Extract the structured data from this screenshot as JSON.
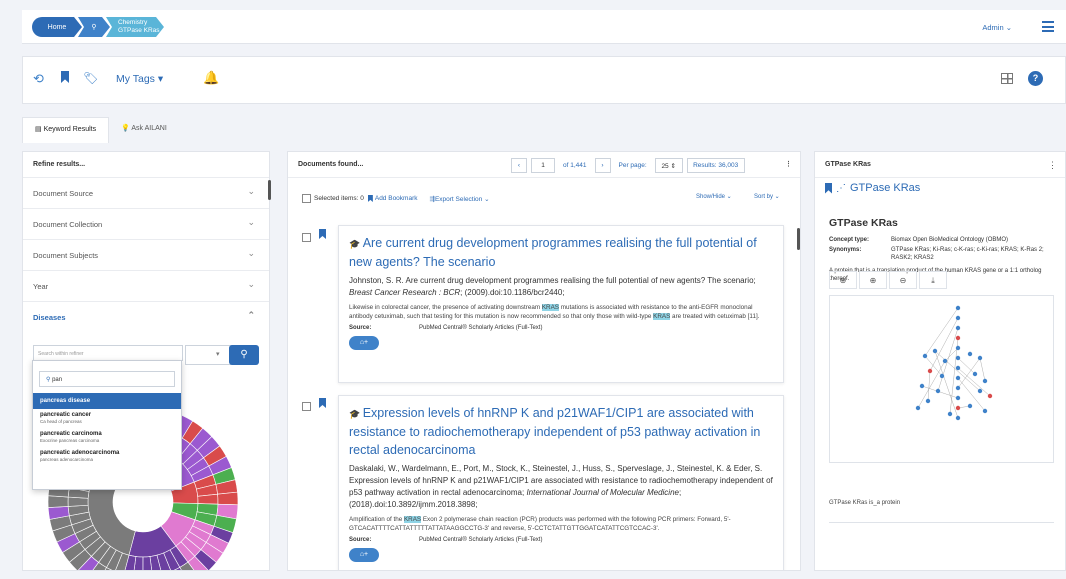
{
  "breadcrumb": {
    "home": "Home",
    "chem_line1": "Chemistry",
    "chem_line2": "GTPase KRas"
  },
  "header": {
    "admin": "Admin ⌄"
  },
  "toolbar": {
    "my_tags": "My Tags ▾"
  },
  "tabs": [
    {
      "label": "Keyword Results"
    },
    {
      "label": "Ask AILANI"
    }
  ],
  "refine": {
    "title": "Refine results...",
    "items": [
      "Document Source",
      "Document Collection",
      "Document Subjects",
      "Year",
      "Diseases"
    ],
    "search_placeholder": "Search within refiner",
    "dropdown_query": "pan",
    "options": [
      {
        "label": "pancreas disease",
        "sub": ""
      },
      {
        "label": "pancreatic cancer",
        "sub": "Ca head of pancreas"
      },
      {
        "label": "pancreatic carcinoma",
        "sub": "Exocrine pancreas carcinoma"
      },
      {
        "label": "pancreatic adenocarcinoma",
        "sub": "pancreas adenocarcinoma"
      }
    ],
    "sunburst_colors": [
      "#7b7b7b",
      "#9b59d0",
      "#d94b4b",
      "#4caf50",
      "#e07ad0",
      "#6b3fa0"
    ]
  },
  "documents": {
    "title": "Documents found...",
    "page": "1",
    "of": "of 1,441",
    "per_page_label": "Per page:",
    "per_page": "25 ⇕",
    "results": "Results: 36,003",
    "selected": "Selected items: 0",
    "add_bookmark": "Add Bookmark",
    "export": "Export Selection ⌄",
    "show_hide": "Show/Hide ⌄",
    "sort_by": "Sort by ⌄",
    "items": [
      {
        "title": "Are current drug development programmes realising the full potential of new agents? The scenario",
        "cite": "Johnston, S. R. Are current drug development programmes realising the full potential of new agents? The scenario; Breast Cancer Research : BCR; (2009).doi:10.1186/bcr2440;",
        "snip_a": "Likewise in colorectal cancer, the presence of activating downstream ",
        "hl": "KRAS",
        "snip_b": " mutations is associated with resistance to the anti-EGFR monoclonal antibody cetuximab, such that testing for this mutation is now recommended so that only those with wild-type ",
        "snip_c": " are treated with cetuximab [11].",
        "source_label": "Source:",
        "source": "PubMed Central® Scholarly Articles (Full-Text)"
      },
      {
        "title": "Expression levels of hnRNP K and p21WAF1/CIP1 are associated with resistance to radiochemotherapy independent of p53 pathway activation in rectal adenocarcinoma",
        "cite": "Daskalaki, W., Wardelmann, E., Port, M., Stock, K., Steinestel, J., Huss, S., Sperveslage, J., Steinestel, K. & Eder, S. Expression levels of hnRNP K and p21WAF1/CIP1 are associated with resistance to radiochemotherapy independent of p53 pathway activation in rectal adenocarcinoma; International Journal of Molecular Medicine; (2018).doi:10.3892/ijmm.2018.3898;",
        "snip_a": "Amplification of the ",
        "hl": "KRAS",
        "snip_b": " Exon 2 polymerase chain reaction (PCR) products was performed with the following PCR primers: Forward, 5'-GTCACATTTTCATTATTTTTATTATAAGGCCTG-3' and reverse, 5'-CCTCTATTGTTGGATCATATTCGTCCAC-3'.",
        "snip_c": "",
        "source_label": "Source:",
        "source": "PubMed Central® Scholarly Articles (Full-Text)"
      }
    ]
  },
  "concept": {
    "panel_title": "GTPase KRas",
    "header_name": "GTPase KRas",
    "name": "GTPase KRas",
    "type_label": "Concept type:",
    "type": "Biomax Open BioMedical Ontology (OBMO)",
    "syn_label": "Synonyms:",
    "synonyms": "GTPase KRas; Ki-Ras; c-K-ras; c-Ki-ras; KRAS; K-Ras 2; RASK2; KRAS2",
    "description": "A protein that is a translation product of the human KRAS gene or a 1:1 ortholog thereof.",
    "relation": "GTPase KRas is_a protein"
  }
}
